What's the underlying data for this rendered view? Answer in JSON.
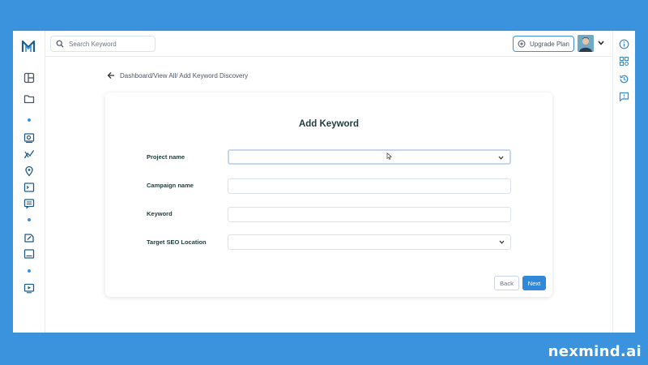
{
  "topbar": {
    "search_placeholder": "Search Keyword",
    "upgrade_label": "Upgrade Plan"
  },
  "breadcrumb": {
    "text": "Dashboard/View All/ Add Keyword Discovery"
  },
  "form": {
    "title": "Add Keyword",
    "fields": [
      {
        "label": "Project name",
        "value": "",
        "type": "select"
      },
      {
        "label": "Campaign name",
        "value": "",
        "type": "text"
      },
      {
        "label": "Keyword",
        "value": "",
        "type": "text"
      },
      {
        "label": "Target SEO Location",
        "value": "",
        "type": "select"
      }
    ],
    "back_label": "Back",
    "next_label": "Next"
  },
  "brand": "nexmind.ai",
  "colors": {
    "background": "#3b93dd",
    "accent": "#2f88d8",
    "text_dark": "#1f3b3a"
  },
  "icons": {
    "sidebar": [
      "logo-icon",
      "layout-icon",
      "folder-icon",
      "image-search-icon",
      "chart-line-icon",
      "location-pin-icon",
      "terminal-icon",
      "message-icon",
      "doc-edit-icon",
      "image-icon",
      "video-play-icon"
    ],
    "right_sidebar": [
      "info-icon",
      "apps-icon",
      "history-icon",
      "feedback-icon"
    ]
  }
}
